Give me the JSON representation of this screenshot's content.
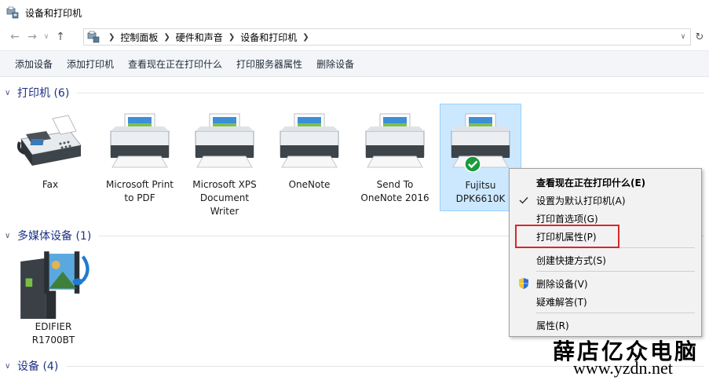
{
  "window": {
    "title": "设备和打印机"
  },
  "address": {
    "crumbs": [
      "控制面板",
      "硬件和声音",
      "设备和打印机"
    ]
  },
  "commands": [
    "添加设备",
    "添加打印机",
    "查看现在正在打印什么",
    "打印服务器属性",
    "删除设备"
  ],
  "groups": {
    "printers": {
      "title": "打印机 (6)"
    },
    "multimedia": {
      "title": "多媒体设备 (1)"
    },
    "devices": {
      "title": "设备 (4)"
    }
  },
  "printers": [
    {
      "label": "Fax",
      "icon": "fax-icon"
    },
    {
      "label": "Microsoft Print to PDF",
      "icon": "printer-icon"
    },
    {
      "label": "Microsoft XPS Document Writer",
      "icon": "printer-icon"
    },
    {
      "label": "OneNote",
      "icon": "printer-icon"
    },
    {
      "label": "Send To OneNote 2016",
      "icon": "printer-icon"
    },
    {
      "label": "Fujitsu DPK6610K",
      "icon": "printer-icon",
      "default": true,
      "selected": true
    }
  ],
  "multimedia": [
    {
      "label": "EDIFIER R1700BT",
      "icon": "media-device-icon"
    }
  ],
  "context_menu": {
    "items": [
      {
        "label": "查看现在正在打印什么(E)",
        "bold": true
      },
      {
        "label": "设置为默认打印机(A)",
        "checked": true
      },
      {
        "label": "打印首选项(G)"
      },
      {
        "label": "打印机属性(P)",
        "highlighted": true
      },
      {
        "label": "创建快捷方式(S)"
      },
      {
        "label": "删除设备(V)",
        "shield": true
      },
      {
        "label": "疑难解答(T)"
      },
      {
        "label": "属性(R)"
      }
    ]
  },
  "watermark": {
    "name": "薛店亿众电脑",
    "url": "www.yzdn.net"
  },
  "colors": {
    "accent": "#1e3287",
    "selection": "#cce8ff",
    "highlight_box": "#d8262e",
    "default_check": "#1a9b3c"
  }
}
